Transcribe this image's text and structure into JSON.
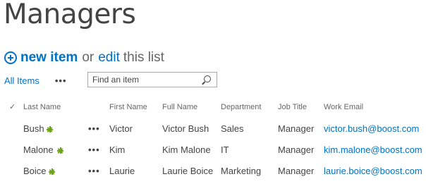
{
  "page_title": "Managers",
  "command_bar": {
    "new_item": "new item",
    "or": "or",
    "edit": "edit",
    "this_list": "this list"
  },
  "view": {
    "current": "All Items",
    "more": "•••"
  },
  "search": {
    "placeholder": "Find an item"
  },
  "table": {
    "select_all_glyph": "✓",
    "columns": [
      "Last Name",
      "First Name",
      "Full Name",
      "Department",
      "Job Title",
      "Work Email"
    ],
    "row_menu_glyph": "•••",
    "rows": [
      {
        "last": "Bush",
        "first": "Victor",
        "full": "Victor Bush",
        "dept": "Sales",
        "title": "Manager",
        "email": "victor.bush@boost.com",
        "is_new": true
      },
      {
        "last": "Malone",
        "first": "Kim",
        "full": "Kim Malone",
        "dept": "IT",
        "title": "Manager",
        "email": "kim.malone@boost.com",
        "is_new": true
      },
      {
        "last": "Boice",
        "first": "Laurie",
        "full": "Laurie Boice",
        "dept": "Marketing",
        "title": "Manager",
        "email": "laurie.boice@boost.com",
        "is_new": true
      }
    ]
  },
  "colors": {
    "accent": "#0072c6",
    "text": "#444444",
    "new_indicator": "#6ba315"
  },
  "icons": {
    "add": "plus-circle-icon",
    "search": "magnifier-icon",
    "new": "new-item-indicator-icon"
  }
}
